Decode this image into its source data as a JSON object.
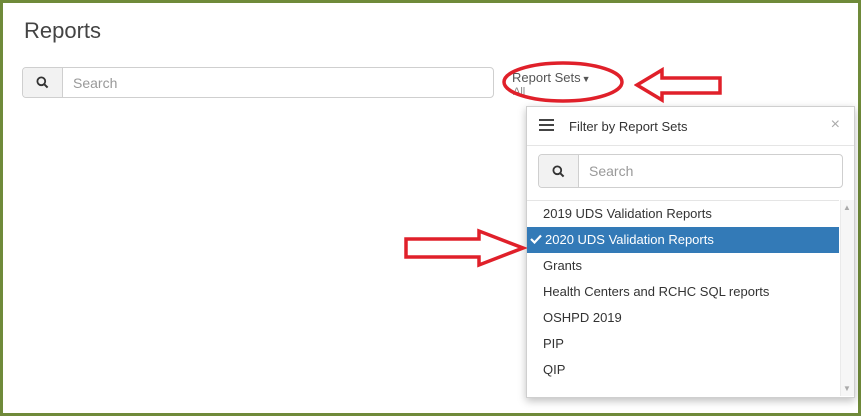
{
  "page": {
    "title": "Reports"
  },
  "search": {
    "placeholder": "Search",
    "icon": "search-icon"
  },
  "report_sets": {
    "label": "Report Sets",
    "current": "All"
  },
  "filter_panel": {
    "title": "Filter by Report Sets",
    "close": "×",
    "search_placeholder": "Search",
    "items": [
      {
        "label": "2019 UDS Validation Reports",
        "selected": false
      },
      {
        "label": "2020 UDS Validation Reports",
        "selected": true
      },
      {
        "label": "Grants",
        "selected": false
      },
      {
        "label": "Health Centers and RCHC SQL reports",
        "selected": false
      },
      {
        "label": "OSHPD 2019",
        "selected": false
      },
      {
        "label": "PIP",
        "selected": false
      },
      {
        "label": "QIP",
        "selected": false
      }
    ]
  },
  "colors": {
    "frame_border": "#6f8a3a",
    "selected_bg": "#337ab7",
    "annotation_red": "#e0202a"
  }
}
